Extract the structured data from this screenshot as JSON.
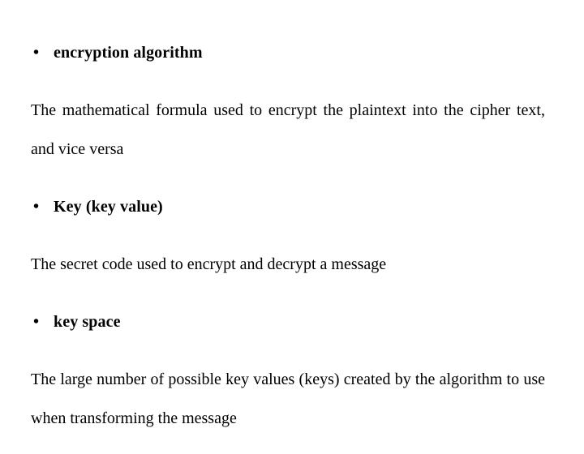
{
  "slide": {
    "background_color": "#ffffff",
    "text_color": "#000000",
    "bullet_glyph": "•",
    "blocks": [
      {
        "type": "bullet",
        "label": "encryption algorithm"
      },
      {
        "type": "paragraph",
        "text": "The mathematical formula used to encrypt the plaintext into the cipher text, and vice versa",
        "justified": true
      },
      {
        "type": "bullet",
        "label": "Key (key value)"
      },
      {
        "type": "paragraph",
        "text": "The secret code used to encrypt and decrypt a message",
        "justified": false
      },
      {
        "type": "bullet",
        "label": "key space"
      },
      {
        "type": "paragraph",
        "text": "The large number of possible key values (keys) created by the algorithm to use when transforming the message",
        "justified": true
      }
    ]
  }
}
